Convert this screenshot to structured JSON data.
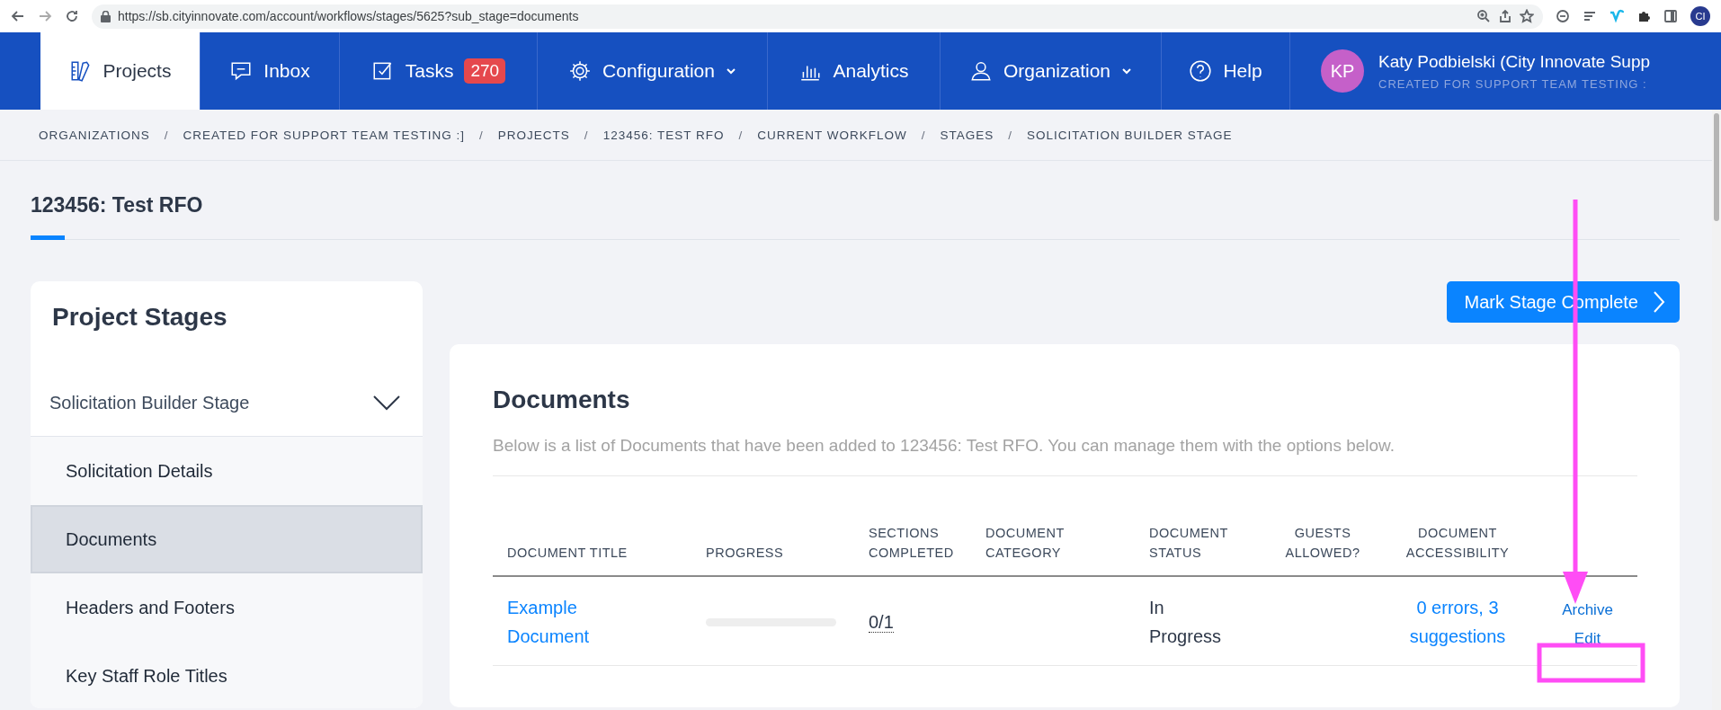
{
  "browser": {
    "url": "https://sb.cityinnovate.com/account/workflows/stages/5625?sub_stage=documents",
    "profile_initials": "CI"
  },
  "nav": {
    "items": [
      {
        "label": "Projects",
        "selected": true,
        "dropdown": false
      },
      {
        "label": "Inbox",
        "selected": false,
        "dropdown": false
      },
      {
        "label": "Tasks",
        "selected": false,
        "dropdown": false,
        "badge": "270"
      },
      {
        "label": "Configuration",
        "selected": false,
        "dropdown": true
      },
      {
        "label": "Analytics",
        "selected": false,
        "dropdown": false
      },
      {
        "label": "Organization",
        "selected": false,
        "dropdown": true
      },
      {
        "label": "Help",
        "selected": false,
        "dropdown": false
      }
    ],
    "user": {
      "initials": "KP",
      "name": "Katy Podbielski (City Innovate Supp",
      "subtitle": "CREATED FOR SUPPORT TEAM TESTING :"
    }
  },
  "breadcrumb_separator": "/",
  "breadcrumbs": [
    "ORGANIZATIONS",
    "CREATED FOR SUPPORT TEAM TESTING :]",
    "PROJECTS",
    "123456: TEST RFO",
    "CURRENT WORKFLOW",
    "STAGES",
    "SOLICITATION BUILDER STAGE"
  ],
  "page_title": "123456: Test RFO",
  "sidebar": {
    "title": "Project Stages",
    "stage": {
      "label": "Solicitation Builder Stage",
      "expanded": true
    },
    "items": [
      {
        "label": "Solicitation Details",
        "selected": false
      },
      {
        "label": "Documents",
        "selected": true
      },
      {
        "label": "Headers and Footers",
        "selected": false
      },
      {
        "label": "Key Staff Role Titles",
        "selected": false
      }
    ]
  },
  "mark_complete_button": "Mark Stage Complete",
  "documents": {
    "title": "Documents",
    "description": "Below is a list of Documents that have been added to 123456: Test RFO. You can manage them with the options below.",
    "columns": [
      [
        "DOCUMENT TITLE"
      ],
      [
        "PROGRESS"
      ],
      [
        "SECTIONS",
        "COMPLETED"
      ],
      [
        "DOCUMENT",
        "CATEGORY"
      ],
      [
        "DOCUMENT",
        "STATUS"
      ],
      [
        "GUESTS",
        "ALLOWED?"
      ],
      [
        "DOCUMENT",
        "ACCESSIBILITY"
      ]
    ],
    "rows": [
      {
        "title": "Example Document",
        "progress": {
          "level": 0
        },
        "sections_completed": "0/1",
        "status": "In Progress",
        "accessibility": "0 errors, 3 suggestions",
        "actions": [
          "Archive",
          "Edit"
        ]
      }
    ]
  }
}
